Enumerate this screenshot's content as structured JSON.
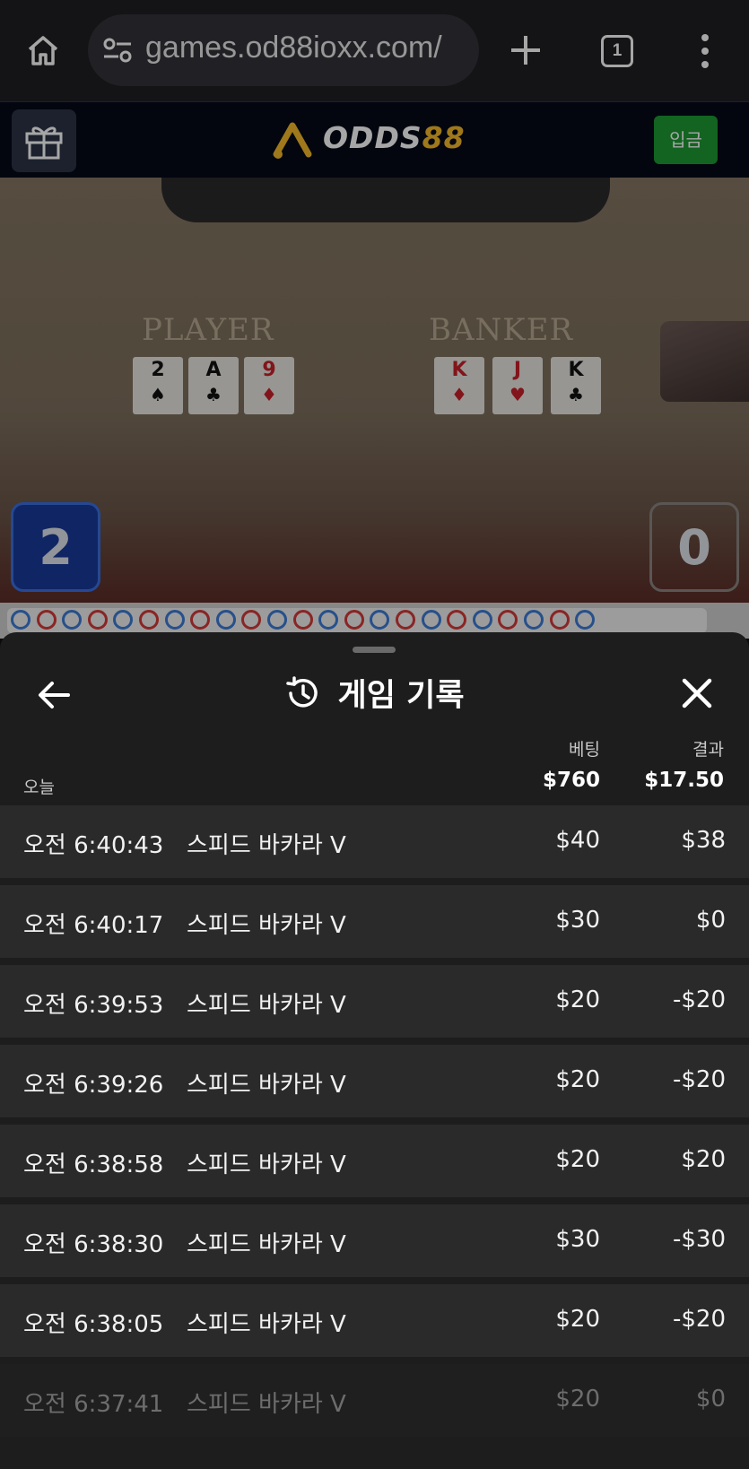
{
  "browser": {
    "url": "games.od88ioxx.com/",
    "tab_count": "1",
    "icons": [
      "home-icon",
      "site-settings-icon",
      "new-tab-icon",
      "tab-switcher-icon",
      "more-menu-icon"
    ]
  },
  "site_header": {
    "logo_white": "ODDS",
    "logo_gold": "88",
    "deposit_label": "입금",
    "colors": {
      "header_bg": "#050a18",
      "deposit_green": "#1d9a32",
      "logo_gold": "#f4b92a"
    }
  },
  "game": {
    "player_label": "PLAYER",
    "banker_label": "BANKER",
    "player_cards": [
      {
        "rank": "2",
        "suit": "♠",
        "color": "black"
      },
      {
        "rank": "A",
        "suit": "♣",
        "color": "black"
      },
      {
        "rank": "9",
        "suit": "♦",
        "color": "red"
      }
    ],
    "banker_cards": [
      {
        "rank": "K",
        "suit": "♦",
        "color": "red"
      },
      {
        "rank": "J",
        "suit": "♥",
        "color": "red"
      },
      {
        "rank": "K",
        "suit": "♣",
        "color": "black"
      }
    ],
    "player_score": "2",
    "banker_score": "0"
  },
  "sheet": {
    "title": "게임 기록",
    "col_bet": "베팅",
    "col_result": "결과",
    "today_label": "오늘",
    "total_bet": "$760",
    "total_result": "$17.50",
    "rows": [
      {
        "time": "오전 6:40:43",
        "game": "스피드 바카라 V",
        "bet": "$40",
        "result": "$38"
      },
      {
        "time": "오전 6:40:17",
        "game": "스피드 바카라 V",
        "bet": "$30",
        "result": "$0"
      },
      {
        "time": "오전 6:39:53",
        "game": "스피드 바카라 V",
        "bet": "$20",
        "result": "-$20"
      },
      {
        "time": "오전 6:39:26",
        "game": "스피드 바카라 V",
        "bet": "$20",
        "result": "-$20"
      },
      {
        "time": "오전 6:38:58",
        "game": "스피드 바카라 V",
        "bet": "$20",
        "result": "$20"
      },
      {
        "time": "오전 6:38:30",
        "game": "스피드 바카라 V",
        "bet": "$30",
        "result": "-$30"
      },
      {
        "time": "오전 6:38:05",
        "game": "스피드 바카라 V",
        "bet": "$20",
        "result": "-$20"
      },
      {
        "time": "오전 6:37:41",
        "game": "스피드 바카라 V",
        "bet": "$20",
        "result": "$0"
      }
    ]
  }
}
